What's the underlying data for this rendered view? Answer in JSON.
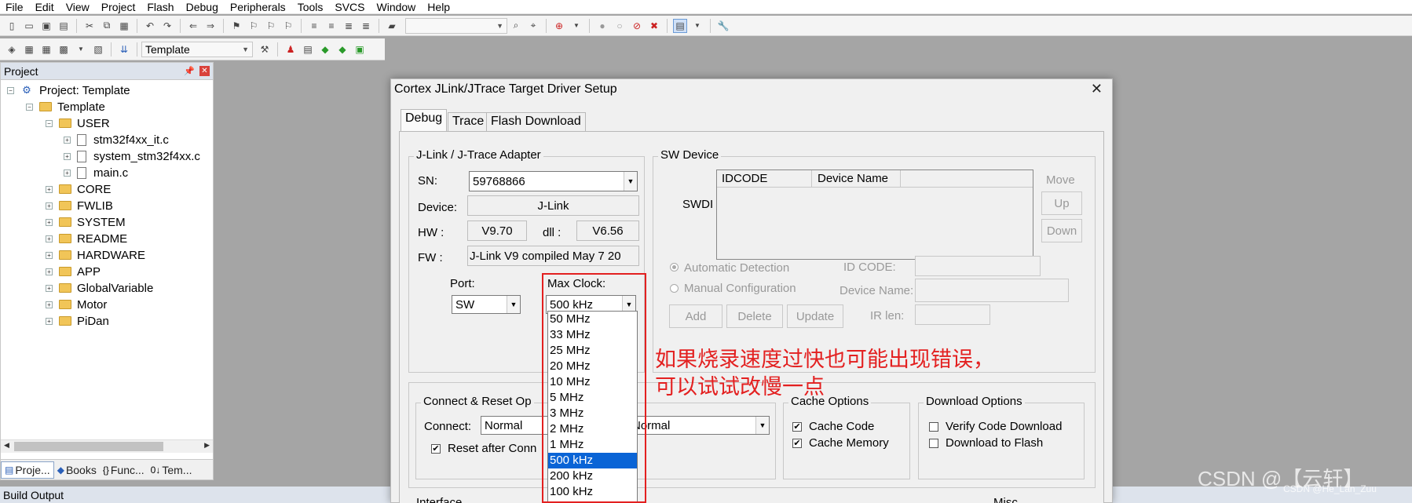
{
  "menu": [
    "File",
    "Edit",
    "View",
    "Project",
    "Flash",
    "Debug",
    "Peripherals",
    "Tools",
    "SVCS",
    "Window",
    "Help"
  ],
  "toolbar2": {
    "target_combo": "Template"
  },
  "project_panel": {
    "title": "Project",
    "tree": {
      "project": "Project: Template",
      "target": "Template",
      "user": "USER",
      "files": [
        "stm32f4xx_it.c",
        "system_stm32f4xx.c",
        "main.c"
      ],
      "groups": [
        "CORE",
        "FWLIB",
        "SYSTEM",
        "README",
        "HARDWARE",
        "APP",
        "GlobalVariable",
        "Motor",
        "PiDan"
      ]
    },
    "tabs": [
      "Proje...",
      "Books",
      "Func...",
      "Tem..."
    ]
  },
  "build_output": "Build Output",
  "dialog": {
    "title": "Cortex JLink/JTrace Target Driver Setup",
    "tabs": [
      "Debug",
      "Trace",
      "Flash Download"
    ],
    "adapter": {
      "legend": "J-Link / J-Trace Adapter",
      "sn_label": "SN:",
      "sn_value": "59768866",
      "device_label": "Device:",
      "device_value": "J-Link",
      "hw_label": "HW :",
      "hw_value": "V9.70",
      "dll_label": "dll :",
      "dll_value": "V6.56",
      "fw_label": "FW :",
      "fw_value": "J-Link V9 compiled May  7 20",
      "port_label": "Port:",
      "port_value": "SW",
      "max_clock_label": "Max Clock:",
      "max_clock_value": "500 kHz"
    },
    "sw_device": {
      "legend": "SW Device",
      "swdi_label": "SWDI",
      "columns": [
        "IDCODE",
        "Device Name"
      ],
      "move_label": "Move",
      "up_button": "Up",
      "down_button": "Down",
      "auto_detect": "Automatic Detection",
      "manual_config": "Manual Configuration",
      "id_code_label": "ID CODE:",
      "device_name_label": "Device Name:",
      "add_button": "Add",
      "delete_button": "Delete",
      "update_button": "Update",
      "ir_len_label": "IR len:"
    },
    "connect_reset": {
      "legend": "Connect & Reset Op",
      "connect_label": "Connect:",
      "connect_value": "Normal",
      "reset_value": "Normal",
      "reset_after_connect": "Reset after Conn"
    },
    "cache_options": {
      "legend": "Cache Options",
      "cache_code": "Cache Code",
      "cache_memory": "Cache Memory"
    },
    "download_options": {
      "legend": "Download Options",
      "verify": "Verify Code Download",
      "download_to_flash": "Download to Flash"
    },
    "interface_legend": "Interface",
    "misc_legend": "Misc",
    "clock_options": [
      "50 MHz",
      "33 MHz",
      "25 MHz",
      "20 MHz",
      "10 MHz",
      "5 MHz",
      "3 MHz",
      "2 MHz",
      "1 MHz",
      "500 kHz",
      "200 kHz",
      "100 kHz"
    ],
    "clock_selected_index": 9
  },
  "annotation": {
    "line1": "如果烧录速度过快也可能出现错误，",
    "line2": "可以试试改慢一点"
  },
  "watermark": {
    "big": "CSDN @【云轩】",
    "small": "CSDN @He_Lan_Zuu"
  },
  "colors": {
    "highlight": "#e32020",
    "selection": "#0a64d6"
  }
}
